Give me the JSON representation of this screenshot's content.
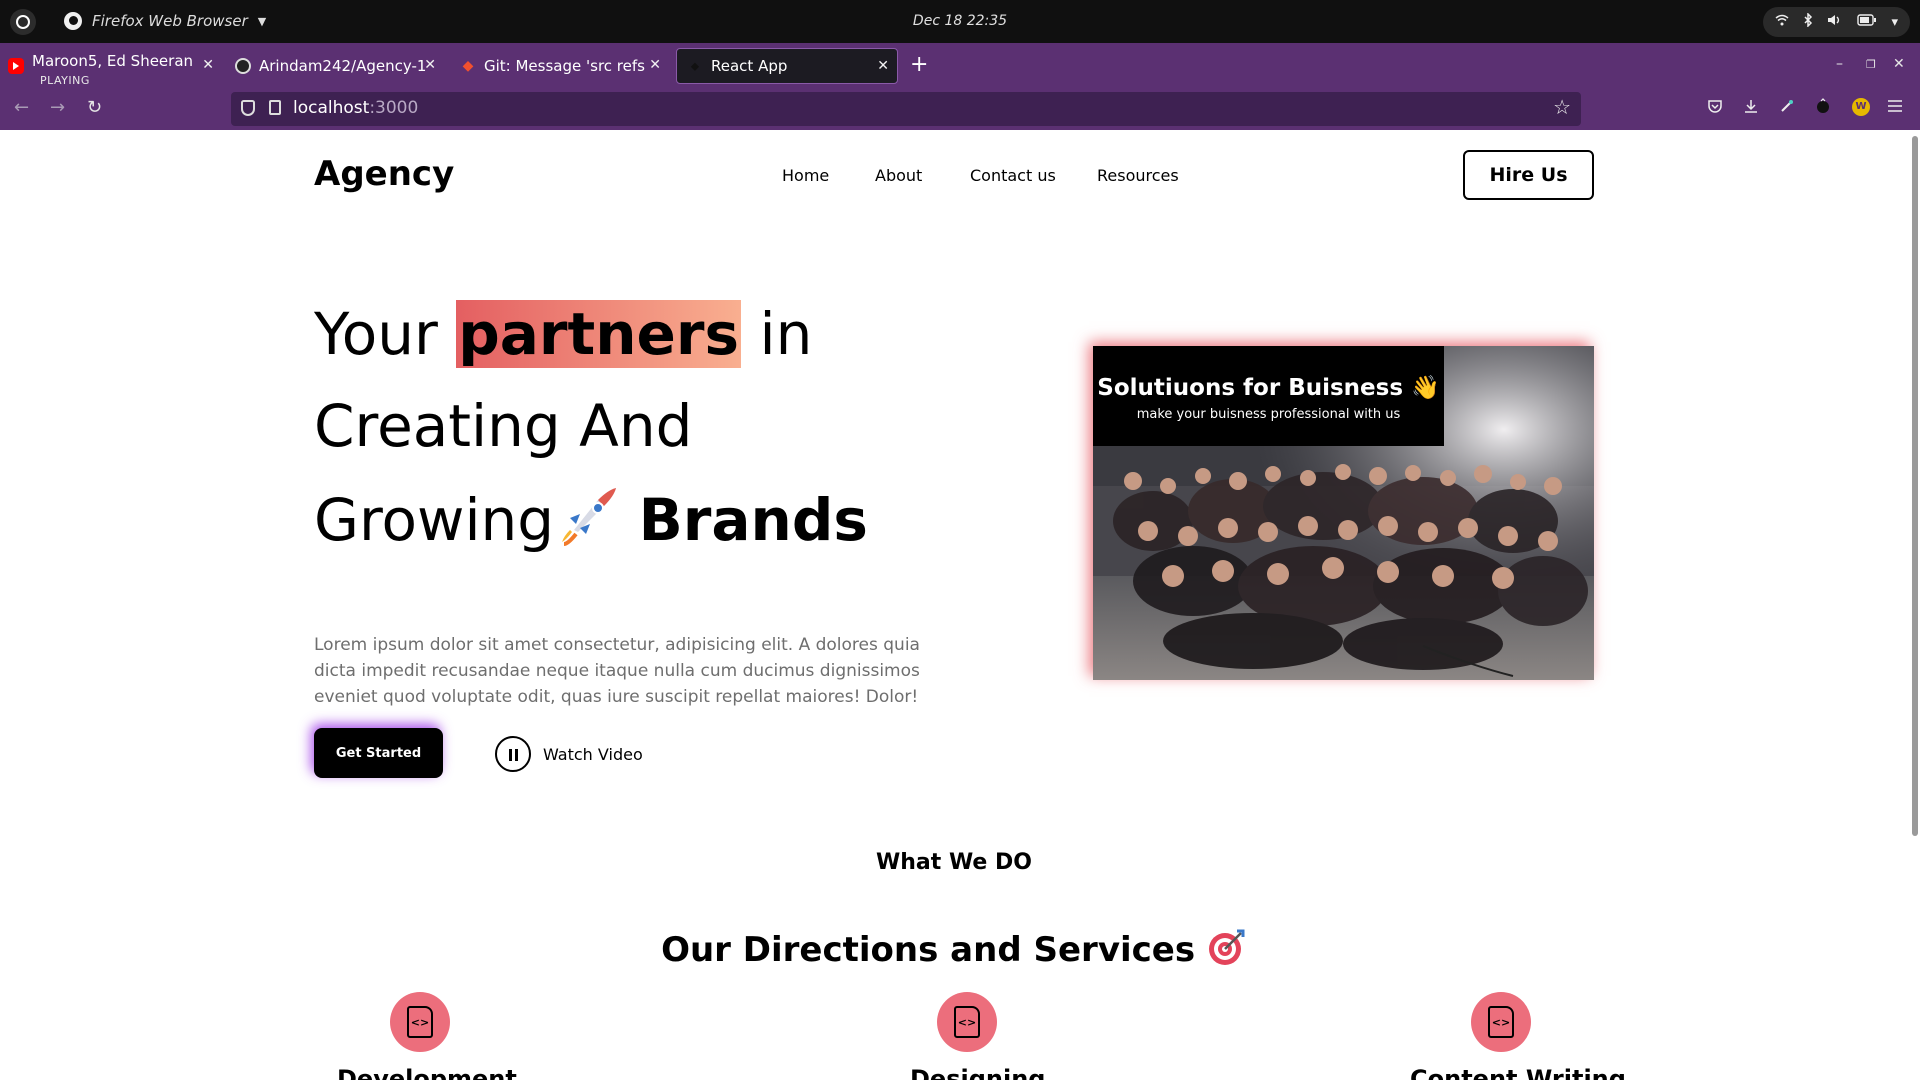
{
  "os": {
    "app_name": "Firefox Web Browser",
    "clock": "Dec 18  22:35"
  },
  "tabs": [
    {
      "label": "Maroon5, Ed Sheeran,",
      "sub": "PLAYING",
      "icon": "youtube-icon"
    },
    {
      "label": "Arindam242/Agency-1",
      "icon": "github-icon"
    },
    {
      "label": "Git: Message 'src refs",
      "icon": "git-icon"
    },
    {
      "label": "React App",
      "icon": "react-icon",
      "active": true
    }
  ],
  "urlbar": {
    "host": "localhost",
    "port": ":3000"
  },
  "site": {
    "brand": "Agency",
    "menu": [
      "Home",
      "About",
      "Contact us",
      "Resources"
    ],
    "hire_label": "Hire Us"
  },
  "hero": {
    "line1_pre": "Your",
    "line1_highlight": "partners",
    "line1_post": "in",
    "line2": "Creating And",
    "line3_pre": "Growing",
    "line3_bold": "Brands",
    "description": "Lorem ipsum dolor sit amet consectetur, adipisicing elit. A dolores quia dicta impedit recusandae neque itaque nulla cum ducimus dignissimos eveniet quod voluptate odit, quas iure suscipit repellat maiores! Dolor!",
    "cta_label": "Get Started",
    "watch_label": "Watch Video"
  },
  "card": {
    "title": "Solutiuons for Buisness 👋",
    "subtitle": "make your buisness professional with us"
  },
  "services": {
    "kicker": "What We DO",
    "heading": "Our Directions and Services",
    "items": [
      {
        "title": "Development"
      },
      {
        "title": "Designing"
      },
      {
        "title": "Content Writing"
      }
    ]
  },
  "colors": {
    "browser_chrome": "#5b3072",
    "highlight_start": "#e45f61",
    "highlight_end": "#f9af90",
    "service_icon_bg": "#ec6e7c"
  }
}
